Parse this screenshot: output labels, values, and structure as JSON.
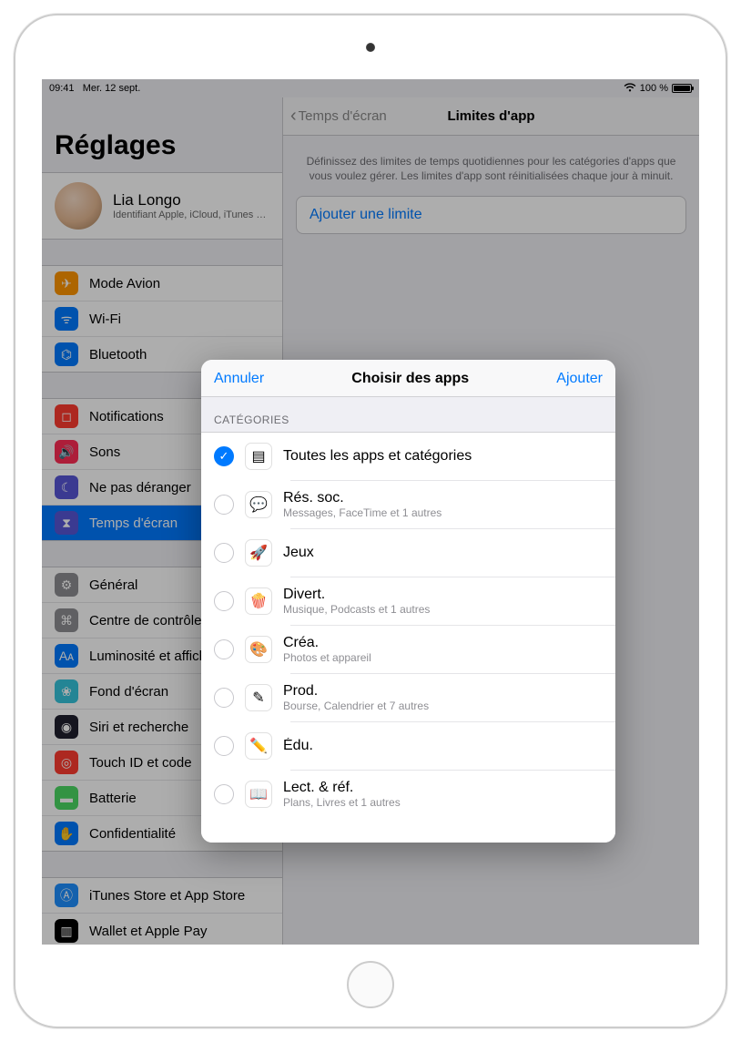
{
  "statusbar": {
    "time": "09:41",
    "date": "Mer. 12 sept.",
    "battery_pct": "100 %",
    "wifi_icon": "wifi-icon"
  },
  "sidebar": {
    "title": "Réglages",
    "profile": {
      "name": "Lia Longo",
      "subtitle": "Identifiant Apple, iCloud, iTunes S…"
    },
    "group_connectivity": [
      {
        "label": "Mode Avion",
        "icon": "airplane-icon",
        "color": "#ff9500"
      },
      {
        "label": "Wi-Fi",
        "icon": "wifi-icon",
        "color": "#007aff"
      },
      {
        "label": "Bluetooth",
        "icon": "bluetooth-icon",
        "color": "#007aff"
      }
    ],
    "group_notifications": [
      {
        "label": "Notifications",
        "icon": "notifications-icon",
        "color": "#ff3b30"
      },
      {
        "label": "Sons",
        "icon": "sounds-icon",
        "color": "#ff2d55"
      },
      {
        "label": "Ne pas déranger",
        "icon": "dnd-icon",
        "color": "#5856d6"
      },
      {
        "label": "Temps d'écran",
        "icon": "screentime-icon",
        "color": "#5856d6",
        "selected": true
      }
    ],
    "group_general": [
      {
        "label": "Général",
        "icon": "general-icon",
        "color": "#8e8e93"
      },
      {
        "label": "Centre de contrôle",
        "icon": "control-center-icon",
        "color": "#8e8e93"
      },
      {
        "label": "Luminosité et affichage",
        "icon": "display-icon",
        "color": "#007aff"
      },
      {
        "label": "Fond d'écran",
        "icon": "wallpaper-icon",
        "color": "#35c4dc"
      },
      {
        "label": "Siri et recherche",
        "icon": "siri-icon",
        "color": "#1f1f2e"
      },
      {
        "label": "Touch ID et code",
        "icon": "touchid-icon",
        "color": "#ff3b30"
      },
      {
        "label": "Batterie",
        "icon": "battery-icon",
        "color": "#4cd964"
      },
      {
        "label": "Confidentialité",
        "icon": "privacy-icon",
        "color": "#007aff"
      }
    ],
    "group_store": [
      {
        "label": "iTunes Store et App Store",
        "icon": "appstore-icon",
        "color": "#1e90ff"
      },
      {
        "label": "Wallet et Apple Pay",
        "icon": "wallet-icon",
        "color": "#000"
      }
    ]
  },
  "detail": {
    "back_label": "Temps d'écran",
    "title": "Limites d'app",
    "description": "Définissez des limites de temps quotidiennes pour les catégories d'apps que vous voulez gérer. Les limites d'app sont réinitialisées chaque jour à minuit.",
    "add_limit_label": "Ajouter une limite"
  },
  "modal": {
    "cancel": "Annuler",
    "title": "Choisir des apps",
    "add": "Ajouter",
    "section_header": "CATÉGORIES",
    "categories": [
      {
        "checked": true,
        "title": "Toutes les apps et catégories",
        "sub": "",
        "icon": "all-apps-icon",
        "icon_glyph": "▤"
      },
      {
        "checked": false,
        "title": "Rés. soc.",
        "sub": "Messages, FaceTime et 1 autres",
        "icon": "social-icon",
        "icon_glyph": "💬"
      },
      {
        "checked": false,
        "title": "Jeux",
        "sub": "",
        "icon": "games-icon",
        "icon_glyph": "🚀"
      },
      {
        "checked": false,
        "title": "Divert.",
        "sub": "Musique, Podcasts et 1 autres",
        "icon": "entertainment-icon",
        "icon_glyph": "🍿"
      },
      {
        "checked": false,
        "title": "Créa.",
        "sub": "Photos et appareil",
        "icon": "creativity-icon",
        "icon_glyph": "🎨"
      },
      {
        "checked": false,
        "title": "Prod.",
        "sub": "Bourse, Calendrier et 7 autres",
        "icon": "productivity-icon",
        "icon_glyph": "✎"
      },
      {
        "checked": false,
        "title": "Édu.",
        "sub": "",
        "icon": "education-icon",
        "icon_glyph": "✏️"
      },
      {
        "checked": false,
        "title": "Lect. & réf.",
        "sub": "Plans, Livres et 1 autres",
        "icon": "reading-icon",
        "icon_glyph": "📖"
      }
    ]
  }
}
